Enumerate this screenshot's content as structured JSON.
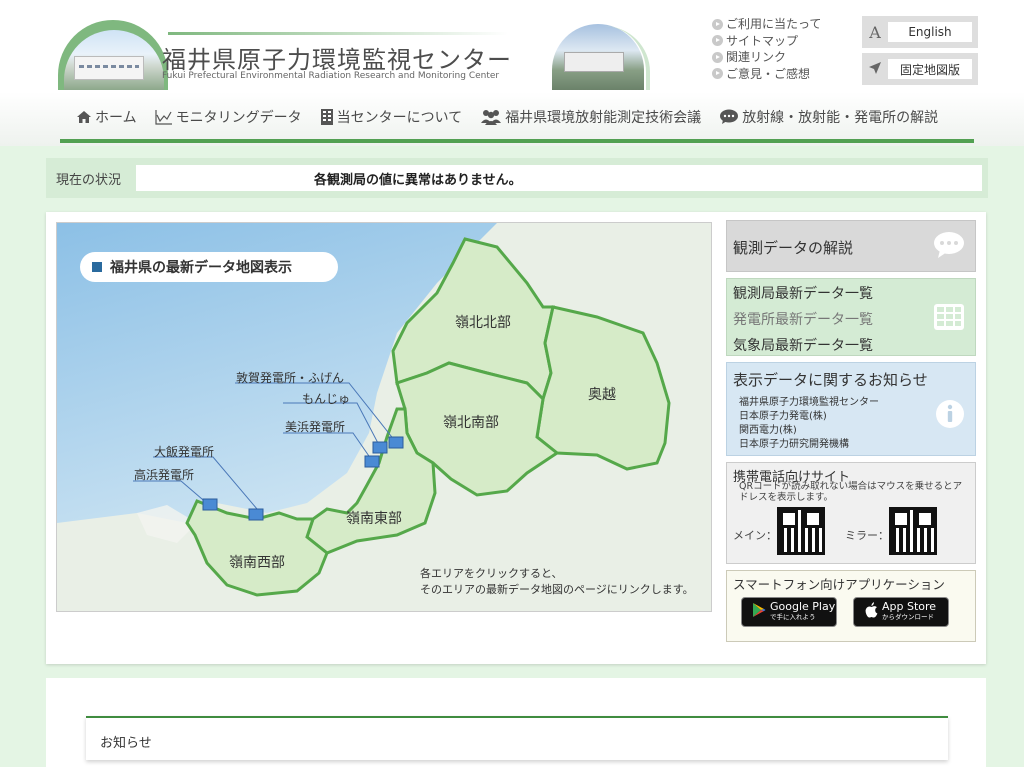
{
  "header": {
    "title": "福井県原子力環境監視センター",
    "subtitle": "Fukui Prefectural Environmental Radiation Research and Monitoring Center",
    "util_links": [
      "ご利用に当たって",
      "サイトマップ",
      "関連リンク",
      "ご意見・ご感想"
    ],
    "english_label": "English",
    "fixed_map_label": "固定地図版",
    "english_icon": "A",
    "accent_color": "#52a052"
  },
  "nav": {
    "items": [
      {
        "label": "ホーム",
        "icon": "home-icon"
      },
      {
        "label": "モニタリングデータ",
        "icon": "chart-icon"
      },
      {
        "label": "当センターについて",
        "icon": "building-icon"
      },
      {
        "label": "福井県環境放射能測定技術会議",
        "icon": "people-icon"
      },
      {
        "label": "放射線・放射能・発電所の解説",
        "icon": "speech-bubble-icon"
      }
    ]
  },
  "status": {
    "label": "現在の状況",
    "message": "各観測局の値に異常はありません。"
  },
  "map": {
    "title": "福井県の最新データ地図表示",
    "regions": [
      "嶺北北部",
      "奥越",
      "嶺北南部",
      "嶺南東部",
      "嶺南西部"
    ],
    "plants": [
      "敦賀発電所・ふげん",
      "もんじゅ",
      "美浜発電所",
      "大飯発電所",
      "高浜発電所"
    ],
    "note_line1": "各エリアをクリックすると、",
    "note_line2": "そのエリアの最新データ地図のページにリンクします。"
  },
  "side": {
    "commentary": "観測データの解説",
    "station_list": "観測局最新データ一覧",
    "plant_list": "発電所最新データ一覧",
    "weather_list": "気象局最新データ一覧",
    "info_title": "表示データに関するお知らせ",
    "info_items": [
      "福井県原子力環境監視センター",
      "日本原子力発電(株)",
      "関西電力(株)",
      "日本原子力研究開発機構"
    ],
    "mobile_title": "携帯電話向けサイト",
    "mobile_note": "QRコードが読み取れない場合はマウスを乗せるとアドレスを表示します。",
    "main_label": "メイン：",
    "mirror_label": "ミラー：",
    "app_title": "スマートフォン向けアプリケーション",
    "google_big": "Google Play",
    "google_small": "で手に入れよう",
    "apple_big": "App Store",
    "apple_small": "からダウンロード"
  },
  "notice": {
    "title": "お知らせ"
  }
}
